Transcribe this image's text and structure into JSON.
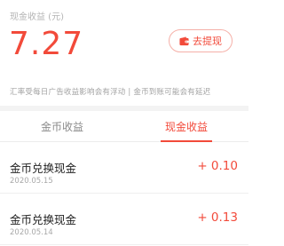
{
  "balance": {
    "label": "现金收益 (元)",
    "amount": "7.27"
  },
  "withdraw_button": {
    "label": "去提现",
    "icon": "wallet-icon"
  },
  "notice": "汇率受每日广告收益影响会有浮动 | 金币到账可能会有延迟",
  "tabs": [
    {
      "label": "金币收益",
      "active": false
    },
    {
      "label": "现金收益",
      "active": true
    }
  ],
  "records": [
    {
      "title": "金币兑换现金",
      "date": "2020.05.15",
      "amount": "+ 0.10"
    },
    {
      "title": "金币兑换现金",
      "date": "2020.05.14",
      "amount": "+ 0.13"
    }
  ],
  "colors": {
    "accent": "#f24a3a",
    "background": "#ffffff",
    "divider": "#f3f3f3"
  }
}
